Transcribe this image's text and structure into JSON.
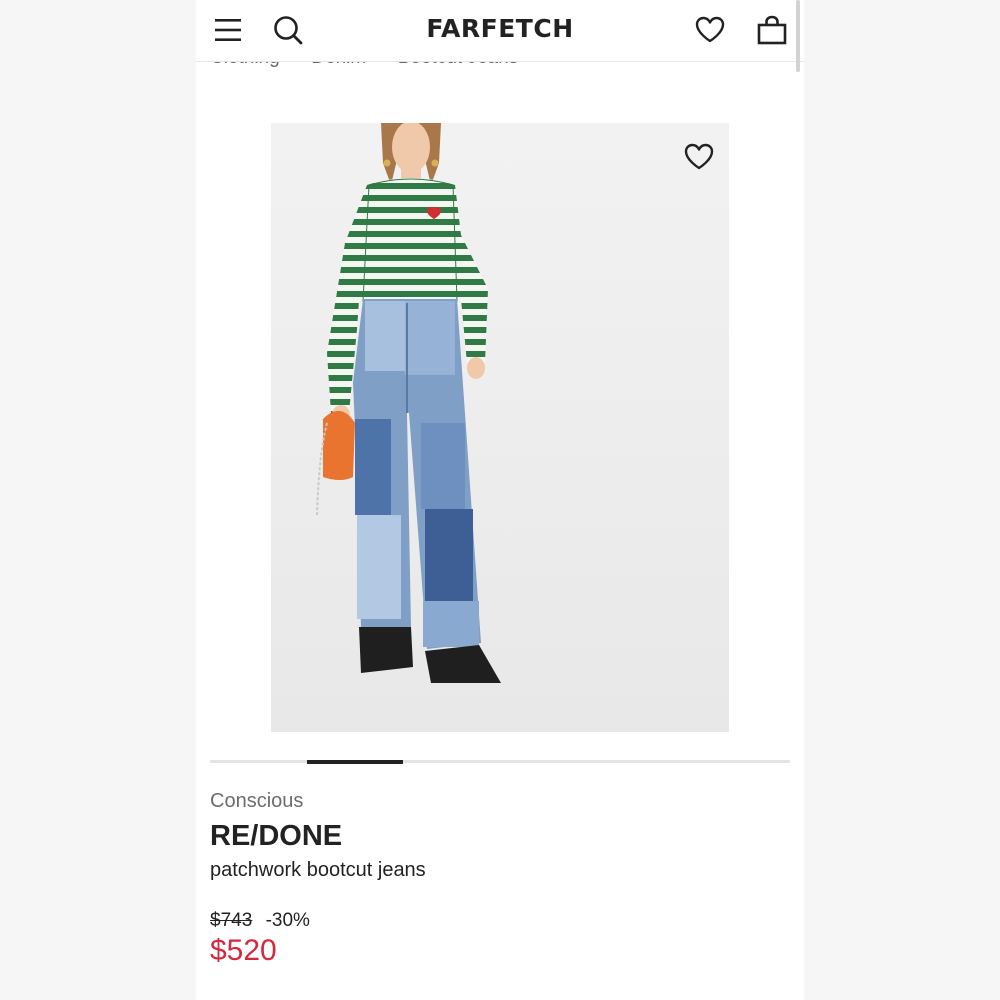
{
  "header": {
    "logo": "FARFETCH",
    "menu_icon": "hamburger-menu-icon",
    "search_icon": "search-icon",
    "wishlist_icon": "heart-outline-icon",
    "bag_icon": "shopping-bag-icon"
  },
  "breadcrumb": {
    "items": [
      "Clothing",
      "Denim",
      "Bootcut Jeans"
    ],
    "separator_icon": "chevron-right-icon"
  },
  "gallery": {
    "favourite_icon": "heart-outline-icon",
    "image_alt": "Model wearing green striped top and patchwork bootcut jeans",
    "active_index": 1,
    "total_images": 6
  },
  "product": {
    "tag": "Conscious",
    "brand": "RE/DONE",
    "name": "patchwork bootcut jeans",
    "original_price": "$743",
    "discount": "-30%",
    "sale_price": "$520"
  },
  "colors": {
    "sale": "#d6283d",
    "text": "#222222",
    "muted": "#6d6d6d"
  }
}
